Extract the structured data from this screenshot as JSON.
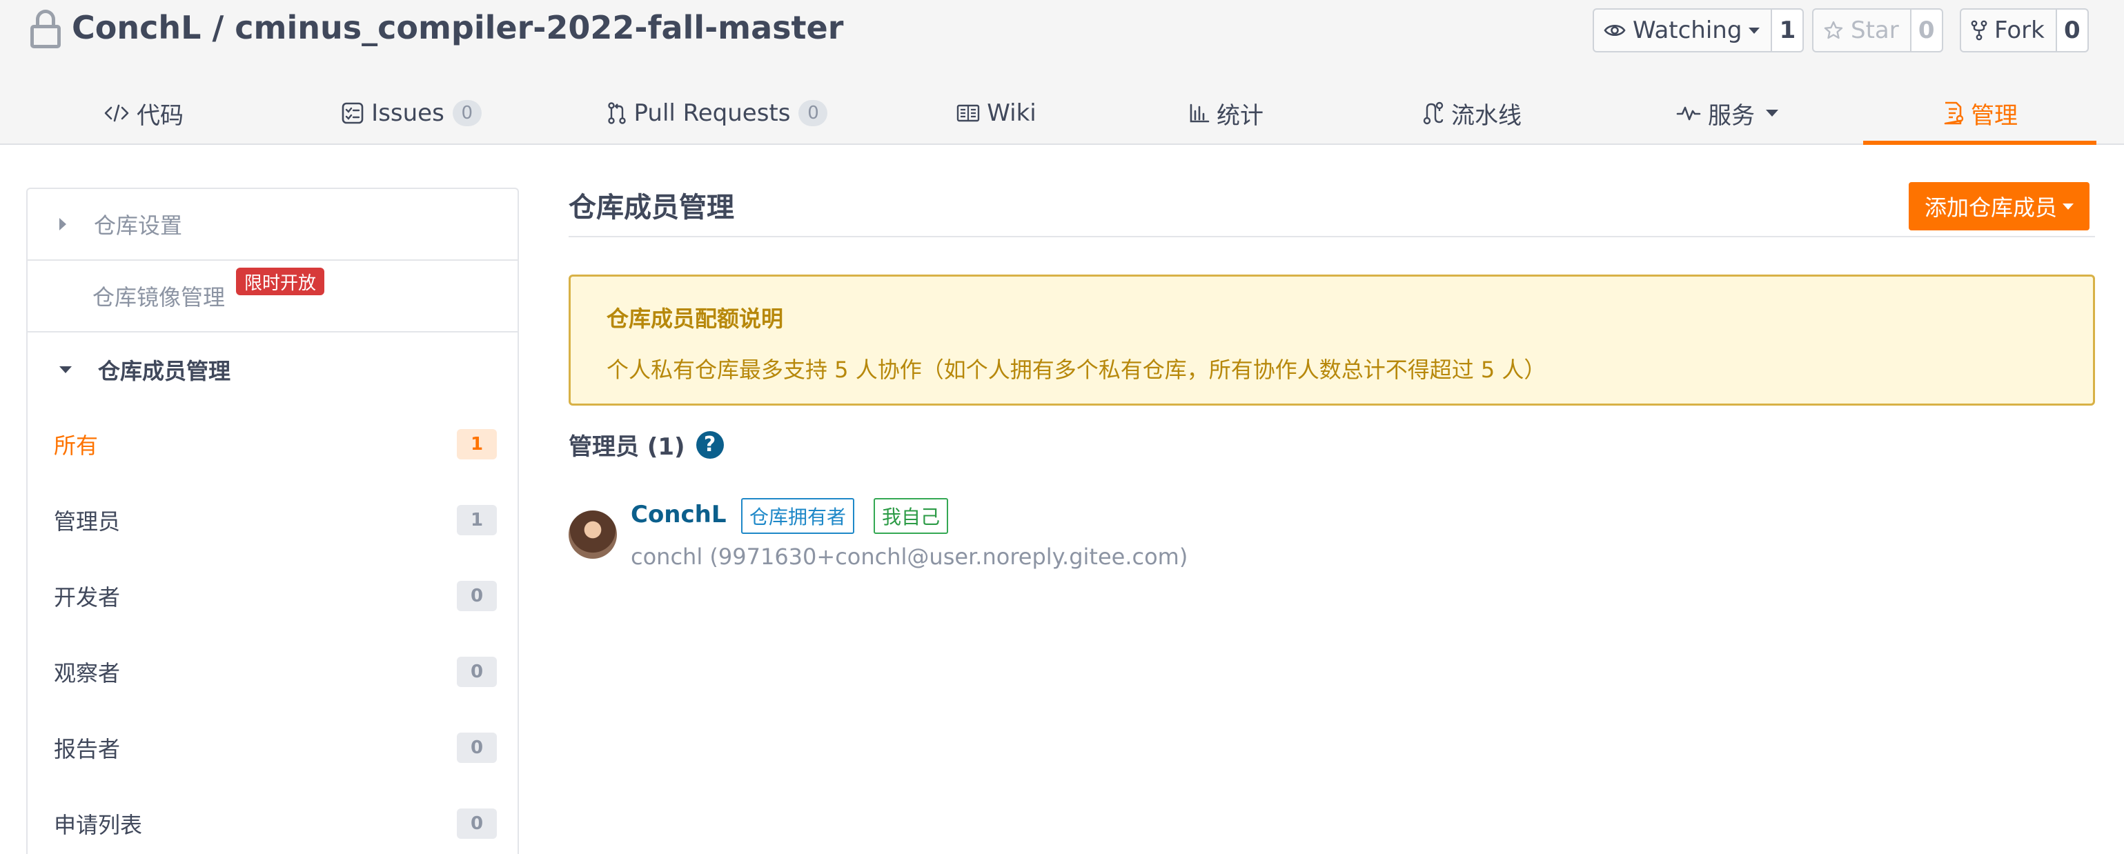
{
  "repo": {
    "owner": "ConchL",
    "separator": " / ",
    "name": "cminus_compiler-2022-fall-master"
  },
  "actions": {
    "watch": {
      "label": "Watching",
      "count": "1"
    },
    "star": {
      "label": "Star",
      "count": "0"
    },
    "fork": {
      "label": "Fork",
      "count": "0"
    }
  },
  "tabs": [
    {
      "label": "代码"
    },
    {
      "label": "Issues",
      "count": "0"
    },
    {
      "label": "Pull Requests",
      "count": "0"
    },
    {
      "label": "Wiki"
    },
    {
      "label": "统计"
    },
    {
      "label": "流水线"
    },
    {
      "label": "服务"
    },
    {
      "label": "管理"
    }
  ],
  "sidebar": {
    "repo_settings": "仓库设置",
    "mirror_mgmt": "仓库镜像管理",
    "limited_badge": "限时开放",
    "member_mgmt": "仓库成员管理",
    "items": [
      {
        "label": "所有",
        "count": "1"
      },
      {
        "label": "管理员",
        "count": "1"
      },
      {
        "label": "开发者",
        "count": "0"
      },
      {
        "label": "观察者",
        "count": "0"
      },
      {
        "label": "报告者",
        "count": "0"
      },
      {
        "label": "申请列表",
        "count": "0"
      }
    ]
  },
  "main": {
    "title": "仓库成员管理",
    "add_button": "添加仓库成员",
    "notice": {
      "title": "仓库成员配额说明",
      "text": "个人私有仓库最多支持 5 人协作（如个人拥有多个私有仓库，所有协作人数总计不得超过 5 人）"
    },
    "admins_heading": "管理员 (1)",
    "help_glyph": "?",
    "member": {
      "name": "ConchL",
      "tag_owner": "仓库拥有者",
      "tag_self": "我自己",
      "email": "conchl (9971630+conchl@user.noreply.gitee.com)"
    }
  },
  "colors": {
    "accent": "#fe7300",
    "link": "#0b5f8c",
    "notice_bg": "#fff8dc",
    "notice_text": "#b7880b",
    "danger_badge": "#d73a3a"
  }
}
